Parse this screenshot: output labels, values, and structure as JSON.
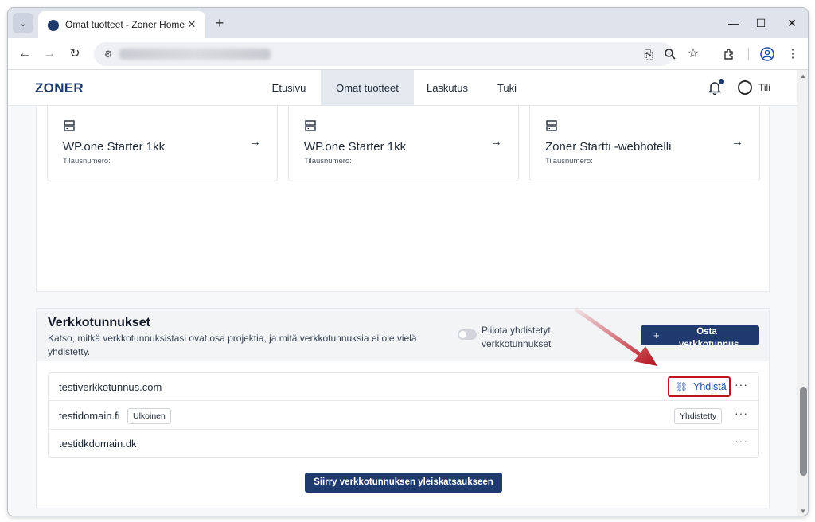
{
  "browser": {
    "tab_title": "Omat tuotteet - Zoner Home",
    "tab_close": "✕",
    "new_tab": "+",
    "tab_dropdown": "⌄",
    "window_buttons": [
      "—",
      "☐",
      "✕"
    ],
    "nav_icons": [
      "arrow-left-icon",
      "arrow-right-icon",
      "reload-icon"
    ],
    "omnibox_icons": [
      "install-app-icon",
      "zoom-icon",
      "bookmark-star-icon"
    ],
    "toolbar_icons": [
      "extensions-icon",
      "profile-icon",
      "menu-icon"
    ]
  },
  "header": {
    "logo": "ZONER",
    "nav": [
      "Etusivu",
      "Omat tuotteet",
      "Laskutus",
      "Tuki"
    ],
    "active_nav": "Omat tuotteet",
    "account_label": "Tili"
  },
  "products": [
    {
      "name": "WP.one Starter 1kk",
      "sub": "Tilausnumero:"
    },
    {
      "name": "WP.one Starter 1kk",
      "sub": "Tilausnumero:"
    },
    {
      "name": "Zoner Startti -webhotelli",
      "sub": "Tilausnumero:"
    }
  ],
  "domains": {
    "title": "Verkkotunnukset",
    "description": "Katso, mitkä verkkotunnuksistasi ovat osa projektia, ja mitä verkkotunnuksia ei ole vielä yhdistetty.",
    "hide_toggle_label": "Piilota yhdistetyt verkkotunnukset",
    "hide_toggle_on": false,
    "buy_button": "Osta verkkotunnus",
    "rows": [
      {
        "name": "testiverkkotunnus.com",
        "action": "Yhdistä",
        "more": "···"
      },
      {
        "name": "testidomain.fi",
        "tag": "Ulkoinen",
        "status": "Yhdistetty",
        "more": "···"
      },
      {
        "name": "testidkdomain.dk",
        "more": "···"
      }
    ],
    "overview_button": "Siirry verkkotunnuksen yleiskatsaukseen"
  },
  "colors": {
    "brand": "#1e3a6e",
    "annotation": "#c1121f",
    "link": "#1e4fa8"
  }
}
